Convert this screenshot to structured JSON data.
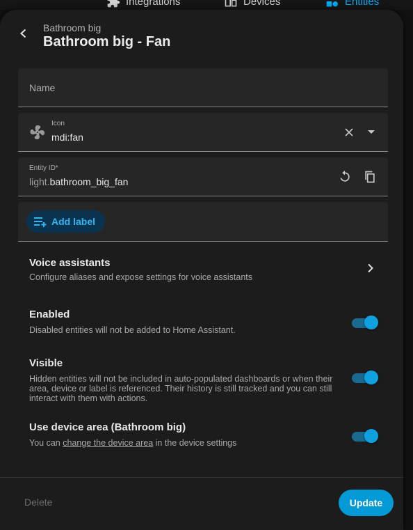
{
  "background_nav": {
    "tabs": [
      {
        "label": "Integrations",
        "icon": "puzzle-icon"
      },
      {
        "label": "Devices",
        "icon": "devices-icon"
      },
      {
        "label": "Entities",
        "icon": "shapes-icon"
      }
    ],
    "active_color": "#03a9f4"
  },
  "dialog": {
    "subtitle": "Bathroom big",
    "title": "Bathroom big - Fan"
  },
  "fields": {
    "name": {
      "label": "Name",
      "value": ""
    },
    "icon": {
      "label": "Icon",
      "value": "mdi:fan"
    },
    "entity_id": {
      "label": "Entity ID*",
      "prefix": "light.",
      "value": "bathroom_big_fan"
    }
  },
  "labels": {
    "add_label": "Add label"
  },
  "voice": {
    "title": "Voice assistants",
    "description": "Configure aliases and expose settings for voice assistants"
  },
  "settings": [
    {
      "title": "Enabled",
      "description": "Disabled entities will not be added to Home Assistant.",
      "on": true
    },
    {
      "title": "Visible",
      "description": "Hidden entities will not be included in auto-populated dashboards or when their area, device or label is referenced. Their history is still tracked and you can still interact with them with actions.",
      "on": true
    },
    {
      "title": "Use device area (Bathroom big)",
      "description_before": "You can ",
      "link": "change the device area",
      "description_after": " in the device settings",
      "on": true
    }
  ],
  "footer": {
    "delete_label": "Delete",
    "update_label": "Update"
  },
  "colors": {
    "accent": "#039ad6",
    "chip_text": "#35b4f0",
    "surface": "#1c1c1c"
  }
}
